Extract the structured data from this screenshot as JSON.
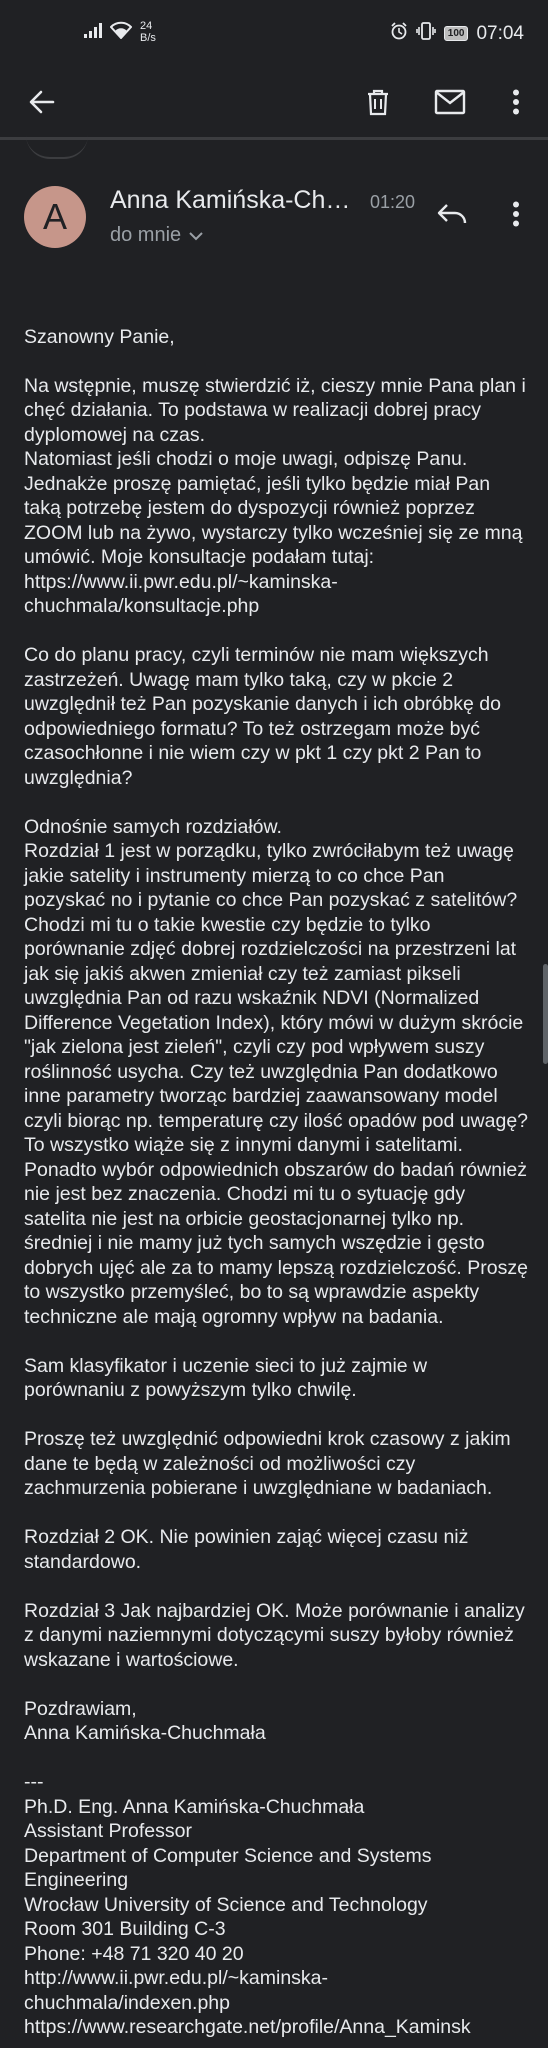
{
  "status_bar": {
    "net_speed_value": "24",
    "net_speed_unit": "B/s",
    "battery": "100",
    "time": "07:04"
  },
  "toolbar": {
    "back_icon": "arrow-back-icon",
    "delete_icon": "trash-icon",
    "mark_unread_icon": "mail-icon",
    "more_icon": "more-vertical-icon"
  },
  "message": {
    "avatar_letter": "A",
    "sender": "Anna Kamińska-Chu…",
    "time": "01:20",
    "recipient": "do mnie",
    "body_paragraphs": [
      "Szanowny Panie,",
      "",
      "Na wstępnie, muszę stwierdzić iż, cieszy mnie Pana plan i chęć działania. To podstawa w realizacji dobrej pracy dyplomowej na czas.",
      "Natomiast jeśli chodzi o moje uwagi, odpiszę Panu. Jednakże proszę pamiętać, jeśli tylko będzie miał Pan taką potrzebę jestem do dyspozycji również poprzez ZOOM lub na żywo, wystarczy tylko wcześniej się ze mną umówić. Moje konsultacje podałam tutaj: https://www.ii.pwr.edu.pl/~kaminska-chuchmala/konsultacje.php",
      "",
      "Co do planu pracy, czyli terminów nie mam większych zastrzeżeń. Uwagę mam tylko taką, czy w pkcie 2 uwzględnił też Pan pozyskanie danych i ich obróbkę do odpowiedniego formatu? To też ostrzegam może być czasochłonne i nie wiem czy w pkt 1 czy pkt 2 Pan to uwzględnia?",
      "",
      "Odnośnie samych rozdziałów.",
      "Rozdział 1 jest w porządku, tylko zwróciłabym też uwagę jakie satelity i instrumenty mierzą to co chce Pan pozyskać no i pytanie co chce Pan pozyskać z satelitów? Chodzi mi tu o takie kwestie czy będzie to tylko porównanie zdjęć dobrej rozdzielczości na przestrzeni lat jak się jakiś akwen zmieniał czy też zamiast pikseli uwzględnia Pan od razu wskaźnik NDVI (Normalized Difference Vegetation Index), który mówi w dużym skrócie \"jak zielona jest zieleń\", czyli czy pod wpływem suszy roślinność usycha. Czy też uwzględnia Pan dodatkowo inne parametry tworząc bardziej zaawansowany model czyli biorąc np. temperaturę czy ilość opadów pod uwagę? To wszystko wiąże się z innymi danymi i satelitami. Ponadto wybór odpowiednich obszarów do badań również nie jest bez znaczenia. Chodzi mi tu o sytuację gdy satelita nie jest na orbicie geostacjonarnej tylko np. średniej i nie mamy już tych samych wszędzie i gęsto dobrych ujęć ale za to mamy lepszą rozdzielczość. Proszę to wszystko przemyśleć, bo to są wprawdzie aspekty techniczne ale mają ogromny wpływ na badania.",
      "",
      "Sam klasyfikator i uczenie sieci to już zajmie w porównaniu z powyższym tylko chwilę.",
      "",
      "Proszę też uwzględnić odpowiedni krok czasowy z jakim dane te będą w zależności od możliwości czy zachmurzenia pobierane i uwzględniane w badaniach.",
      "",
      "Rozdział 2 OK. Nie powinien zająć więcej czasu niż standardowo.",
      "",
      "Rozdział 3 Jak najbardziej OK. Może porównanie i analizy z danymi naziemnymi dotyczącymi suszy byłoby również wskazane i wartościowe.",
      "",
      "Pozdrawiam,",
      "Anna Kamińska-Chuchmała",
      "",
      "---",
      "Ph.D. Eng. Anna Kamińska-Chuchmała",
      "Assistant Professor",
      "Department of Computer Science and Systems Engineering",
      "Wrocław University of Science and Technology",
      "Room 301 Building C-3",
      "Phone: +48 71 320 40 20",
      "http://www.ii.pwr.edu.pl/~kaminska-chuchmala/indexen.php",
      "https://www.researchgate.net/profile/Anna_Kaminsk"
    ]
  },
  "colors": {
    "background": "#202124",
    "text_primary": "#e8eaed",
    "text_secondary": "#9aa0a6",
    "avatar_bg": "#c6968a"
  }
}
